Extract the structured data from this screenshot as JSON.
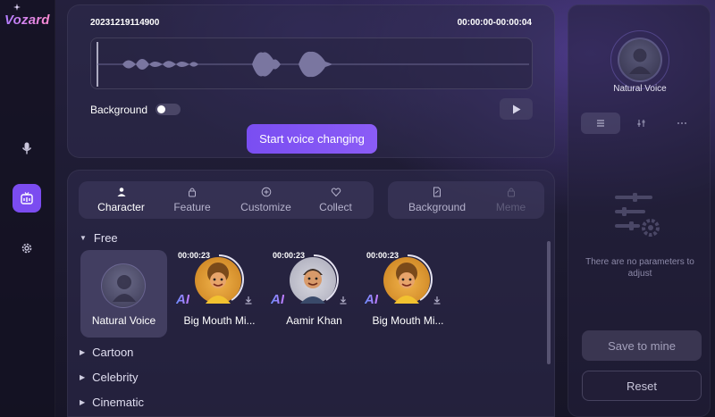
{
  "app": {
    "name": "Vozard"
  },
  "sidebar": {
    "items": [
      {
        "name": "microphone"
      },
      {
        "name": "voice-changer",
        "active": true
      },
      {
        "name": "settings"
      }
    ]
  },
  "recording": {
    "file_name": "20231219114900",
    "time_range": "00:00:00-00:00:04",
    "background_label": "Background",
    "background_enabled": false,
    "start_button": "Start voice changing"
  },
  "tabs": {
    "left": [
      {
        "label": "Character",
        "icon": "person-icon",
        "active": true
      },
      {
        "label": "Feature",
        "icon": "lock-icon"
      },
      {
        "label": "Customize",
        "icon": "plus-circle-icon"
      },
      {
        "label": "Collect",
        "icon": "heart-icon"
      }
    ],
    "right": [
      {
        "label": "Background",
        "icon": "file-icon"
      },
      {
        "label": "Meme",
        "icon": "lock-icon",
        "disabled": true
      }
    ]
  },
  "sections": {
    "free": "Free",
    "cartoon": "Cartoon",
    "celebrity": "Celebrity",
    "cinematic": "Cinematic"
  },
  "voices": [
    {
      "name": "Natural Voice",
      "selected": true
    },
    {
      "name": "Big Mouth Mi...",
      "duration": "00:00:23",
      "ai": "AI"
    },
    {
      "name": "Aamir Khan",
      "duration": "00:00:23",
      "ai": "AI"
    },
    {
      "name": "Big Mouth Mi...",
      "duration": "00:00:23",
      "ai": "AI"
    }
  ],
  "right_panel": {
    "voice_name": "Natural Voice",
    "empty_message": "There are no parameters to adjust",
    "save_button": "Save to mine",
    "reset_button": "Reset"
  },
  "colors": {
    "accent": "#7b4cf0",
    "background": "#1b1930"
  }
}
